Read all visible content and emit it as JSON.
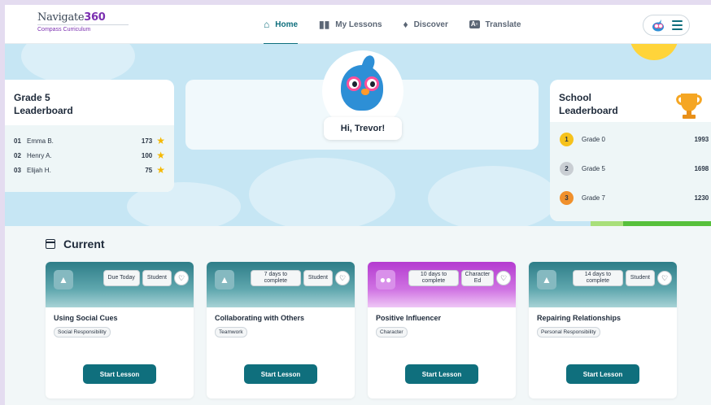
{
  "header": {
    "logo_name": "Navigate",
    "logo_number": "360",
    "logo_subtitle": "Compass Curriculum",
    "nav": [
      {
        "label": "Home",
        "icon": "home-icon",
        "active": true
      },
      {
        "label": "My Lessons",
        "icon": "books-icon",
        "active": false
      },
      {
        "label": "Discover",
        "icon": "compass-icon",
        "active": false
      },
      {
        "label": "Translate",
        "icon": "translate-icon",
        "active": false
      }
    ]
  },
  "hero": {
    "greeting": "Hi, Trevor!"
  },
  "grade_leaderboard": {
    "title_line1": "Grade 5",
    "title_line2": "Leaderboard",
    "rows": [
      {
        "rank": "01",
        "name": "Emma B.",
        "points": "173"
      },
      {
        "rank": "02",
        "name": "Henry A.",
        "points": "100"
      },
      {
        "rank": "03",
        "name": "Elijah H.",
        "points": "75"
      }
    ]
  },
  "school_leaderboard": {
    "title_line1": "School",
    "title_line2": "Leaderboard",
    "rows": [
      {
        "medal": "1",
        "name": "Grade 0",
        "points": "1993",
        "color": "#f6c21c"
      },
      {
        "medal": "2",
        "name": "Grade 5",
        "points": "1698",
        "color": "#c9ced3"
      },
      {
        "medal": "3",
        "name": "Grade 7",
        "points": "1230",
        "color": "#f0902c"
      }
    ]
  },
  "current": {
    "title": "Current",
    "start_label": "Start Lesson",
    "lessons": [
      {
        "title": "Using Social Cues",
        "category": "Social Responsibility",
        "due": "Due Today",
        "audience": "Student",
        "theme": "teal"
      },
      {
        "title": "Collaborating with Others",
        "category": "Teamwork",
        "due": "7 days to complete",
        "audience": "Student",
        "theme": "teal"
      },
      {
        "title": "Positive Influencer",
        "category": "Character",
        "due": "10 days to complete",
        "audience": "Character Ed",
        "theme": "purple"
      },
      {
        "title": "Repairing Relationships",
        "category": "Personal Responsibility",
        "due": "14 days to complete",
        "audience": "Student",
        "theme": "teal"
      }
    ]
  },
  "colors": {
    "accent": "#0f6f7d",
    "brand": "#7b2fb0",
    "star": "#f5b800"
  }
}
